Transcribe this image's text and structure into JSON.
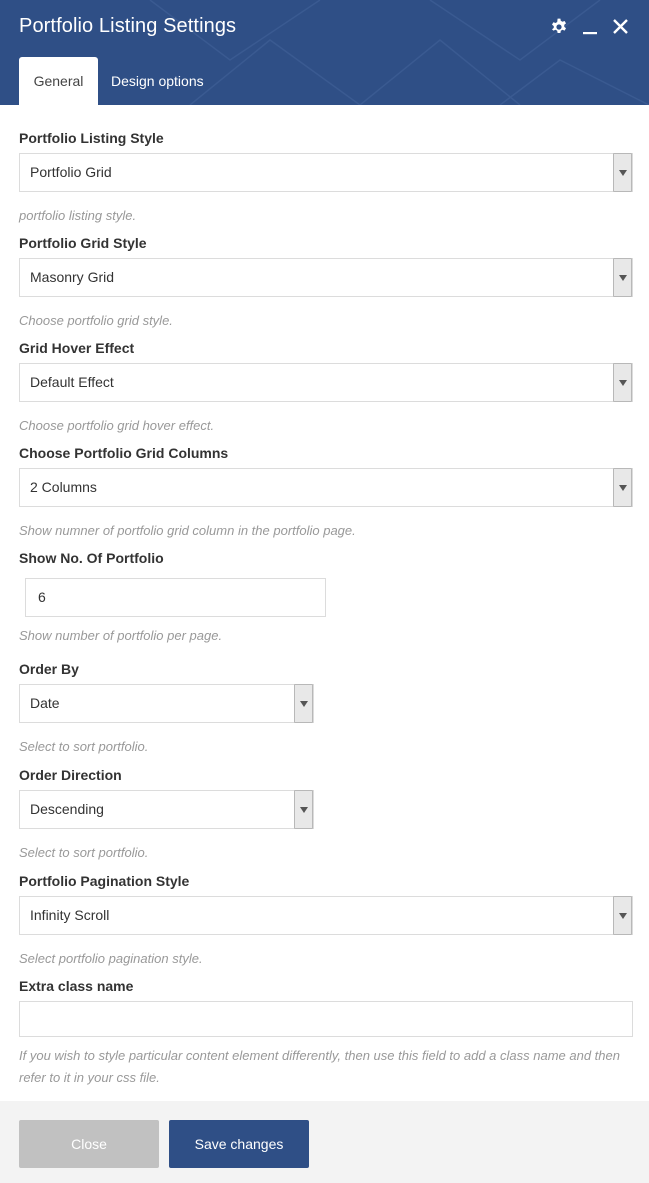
{
  "window": {
    "title": "Portfolio Listing Settings",
    "icons": [
      "gear-icon",
      "minimize-icon",
      "close-icon"
    ],
    "header_color": "#2f4f86"
  },
  "tabs": [
    {
      "label": "General",
      "active": true
    },
    {
      "label": "Design options",
      "active": false
    }
  ],
  "fields": {
    "listing_style": {
      "label": "Portfolio Listing Style",
      "value": "Portfolio Grid",
      "help": "portfolio listing style."
    },
    "grid_style": {
      "label": "Portfolio Grid Style",
      "value": "Masonry Grid",
      "help": "Choose portfolio grid style."
    },
    "hover_effect": {
      "label": "Grid Hover Effect",
      "value": "Default Effect",
      "help": "Choose portfolio grid hover effect."
    },
    "grid_columns": {
      "label": "Choose Portfolio Grid Columns",
      "value": "2 Columns",
      "help": "Show numner of portfolio grid column in the portfolio page."
    },
    "count": {
      "label": "Show No. Of Portfolio",
      "value": "6",
      "help": "Show number of portfolio per page."
    },
    "order_by": {
      "label": "Order By",
      "value": "Date",
      "help": "Select to sort portfolio."
    },
    "order_direction": {
      "label": "Order Direction",
      "value": "Descending",
      "help": "Select to sort portfolio."
    },
    "pagination_style": {
      "label": "Portfolio Pagination Style",
      "value": "Infinity Scroll",
      "help": "Select portfolio pagination style."
    },
    "extra_class": {
      "label": "Extra class name",
      "value": "",
      "help": "If you wish to style particular content element differently, then use this field to add a class name and then refer to it in your css file."
    }
  },
  "footer": {
    "close_label": "Close",
    "save_label": "Save changes"
  }
}
